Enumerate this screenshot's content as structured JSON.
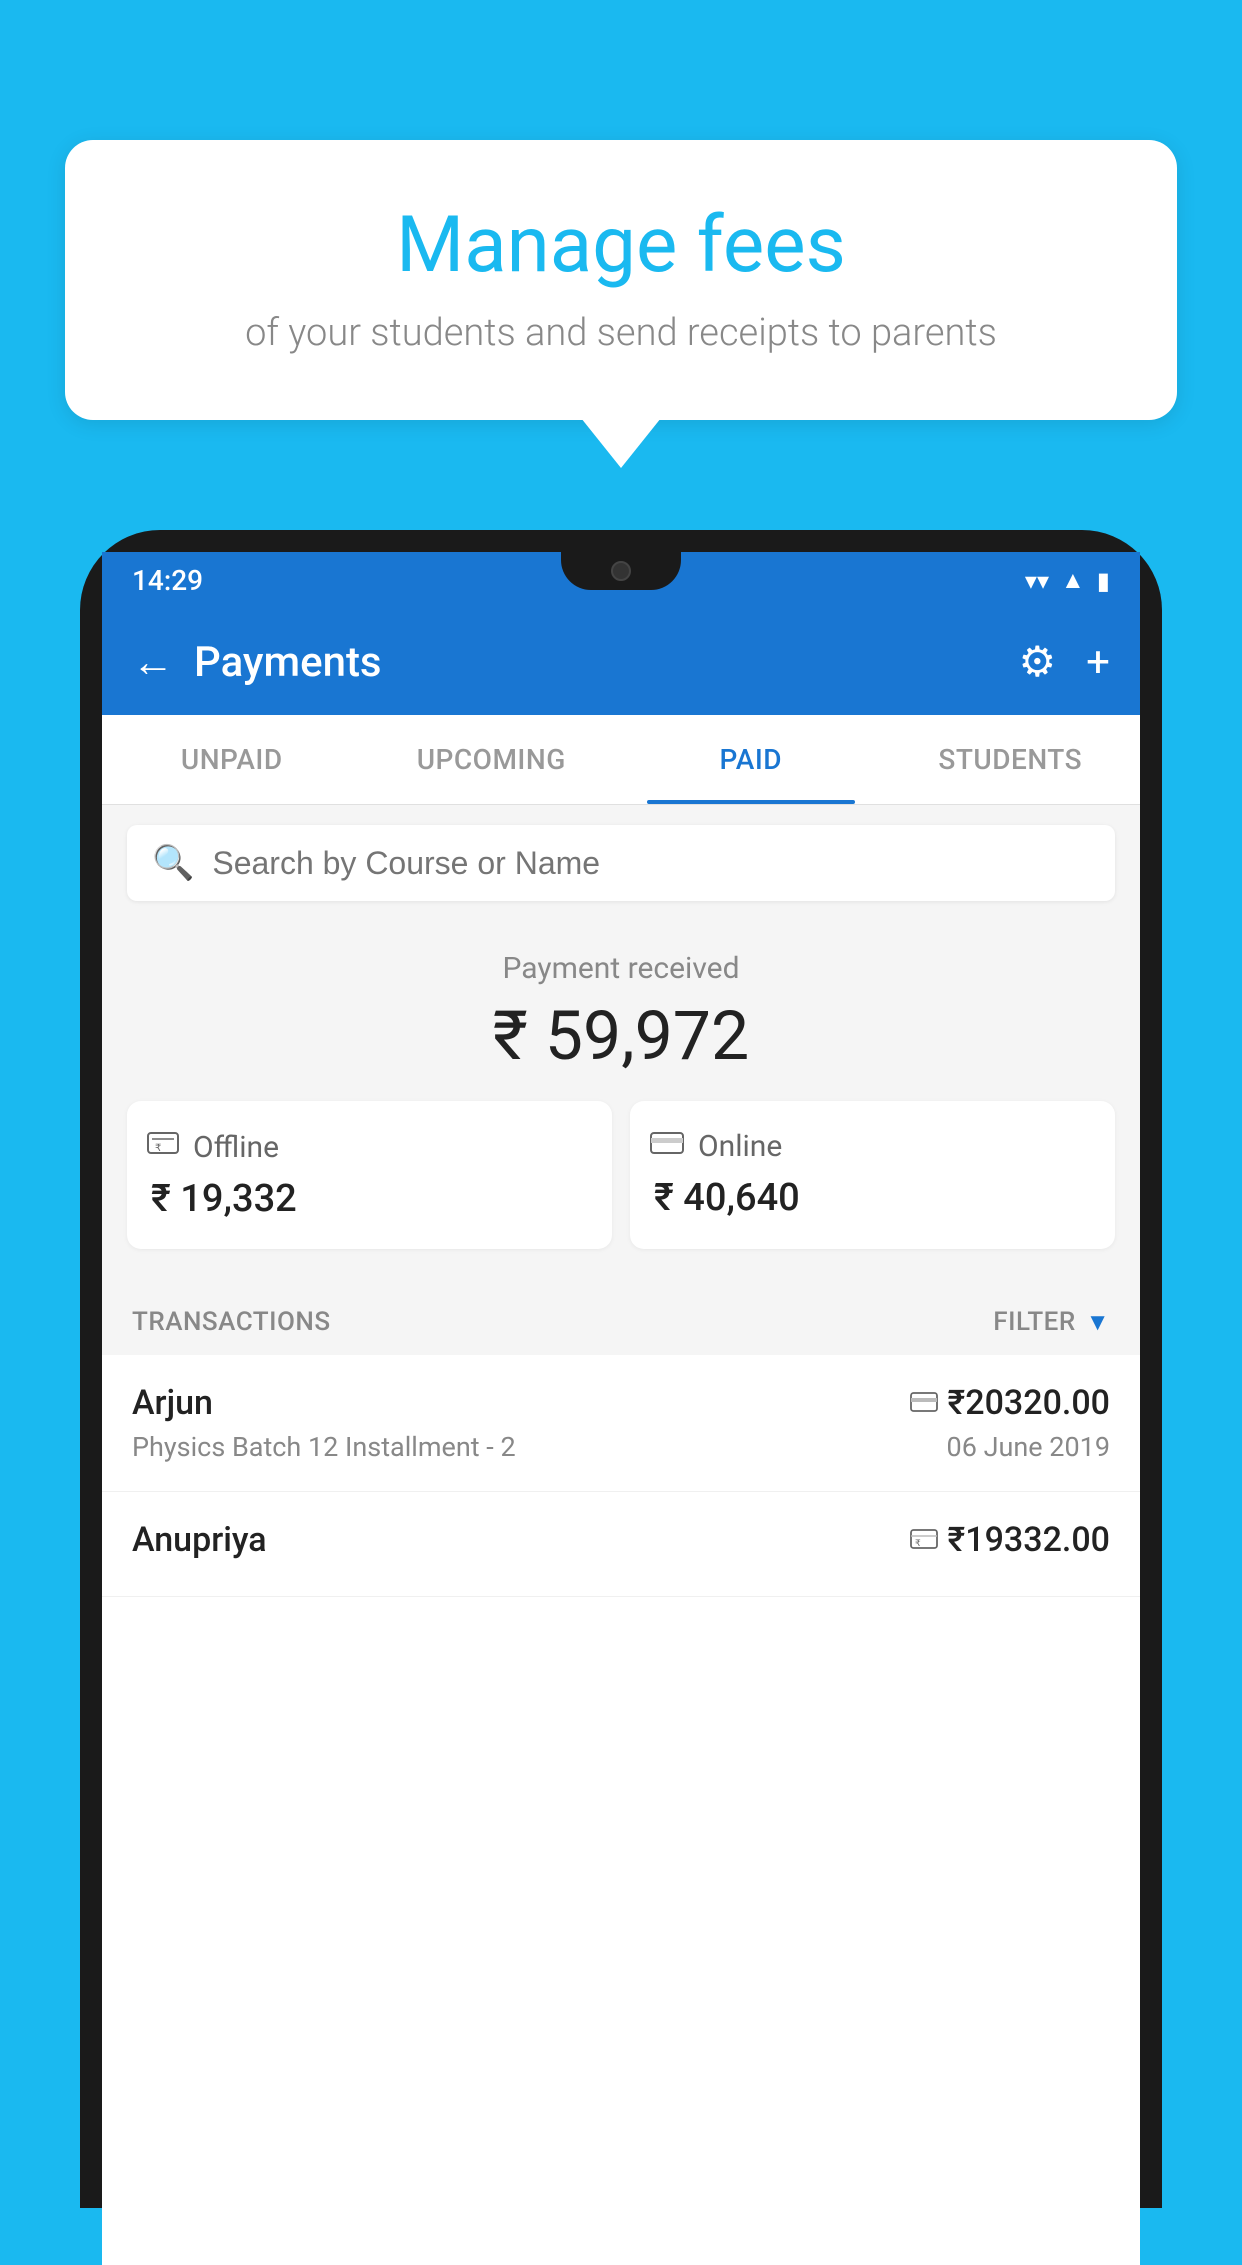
{
  "background_color": "#1ab9f0",
  "speech_bubble": {
    "title": "Manage fees",
    "subtitle": "of your students and send receipts to parents"
  },
  "phone": {
    "status_bar": {
      "time": "14:29",
      "wifi_icon": "▼",
      "signal_icon": "▲",
      "battery_icon": "▮"
    },
    "header": {
      "back_label": "←",
      "title": "Payments",
      "settings_label": "⚙",
      "add_label": "+"
    },
    "tabs": [
      {
        "label": "UNPAID",
        "active": false
      },
      {
        "label": "UPCOMING",
        "active": false
      },
      {
        "label": "PAID",
        "active": true
      },
      {
        "label": "STUDENTS",
        "active": false
      }
    ],
    "search": {
      "placeholder": "Search by Course or Name"
    },
    "payment_summary": {
      "label": "Payment received",
      "amount": "₹ 59,972",
      "offline": {
        "icon": "💳",
        "label": "Offline",
        "amount": "₹ 19,332"
      },
      "online": {
        "icon": "💳",
        "label": "Online",
        "amount": "₹ 40,640"
      }
    },
    "transactions": {
      "header_label": "TRANSACTIONS",
      "filter_label": "FILTER",
      "rows": [
        {
          "name": "Arjun",
          "pay_type": "online",
          "amount": "₹20320.00",
          "course": "Physics Batch 12 Installment - 2",
          "date": "06 June 2019"
        },
        {
          "name": "Anupriya",
          "pay_type": "offline",
          "amount": "₹19332.00",
          "course": "",
          "date": ""
        }
      ]
    }
  }
}
